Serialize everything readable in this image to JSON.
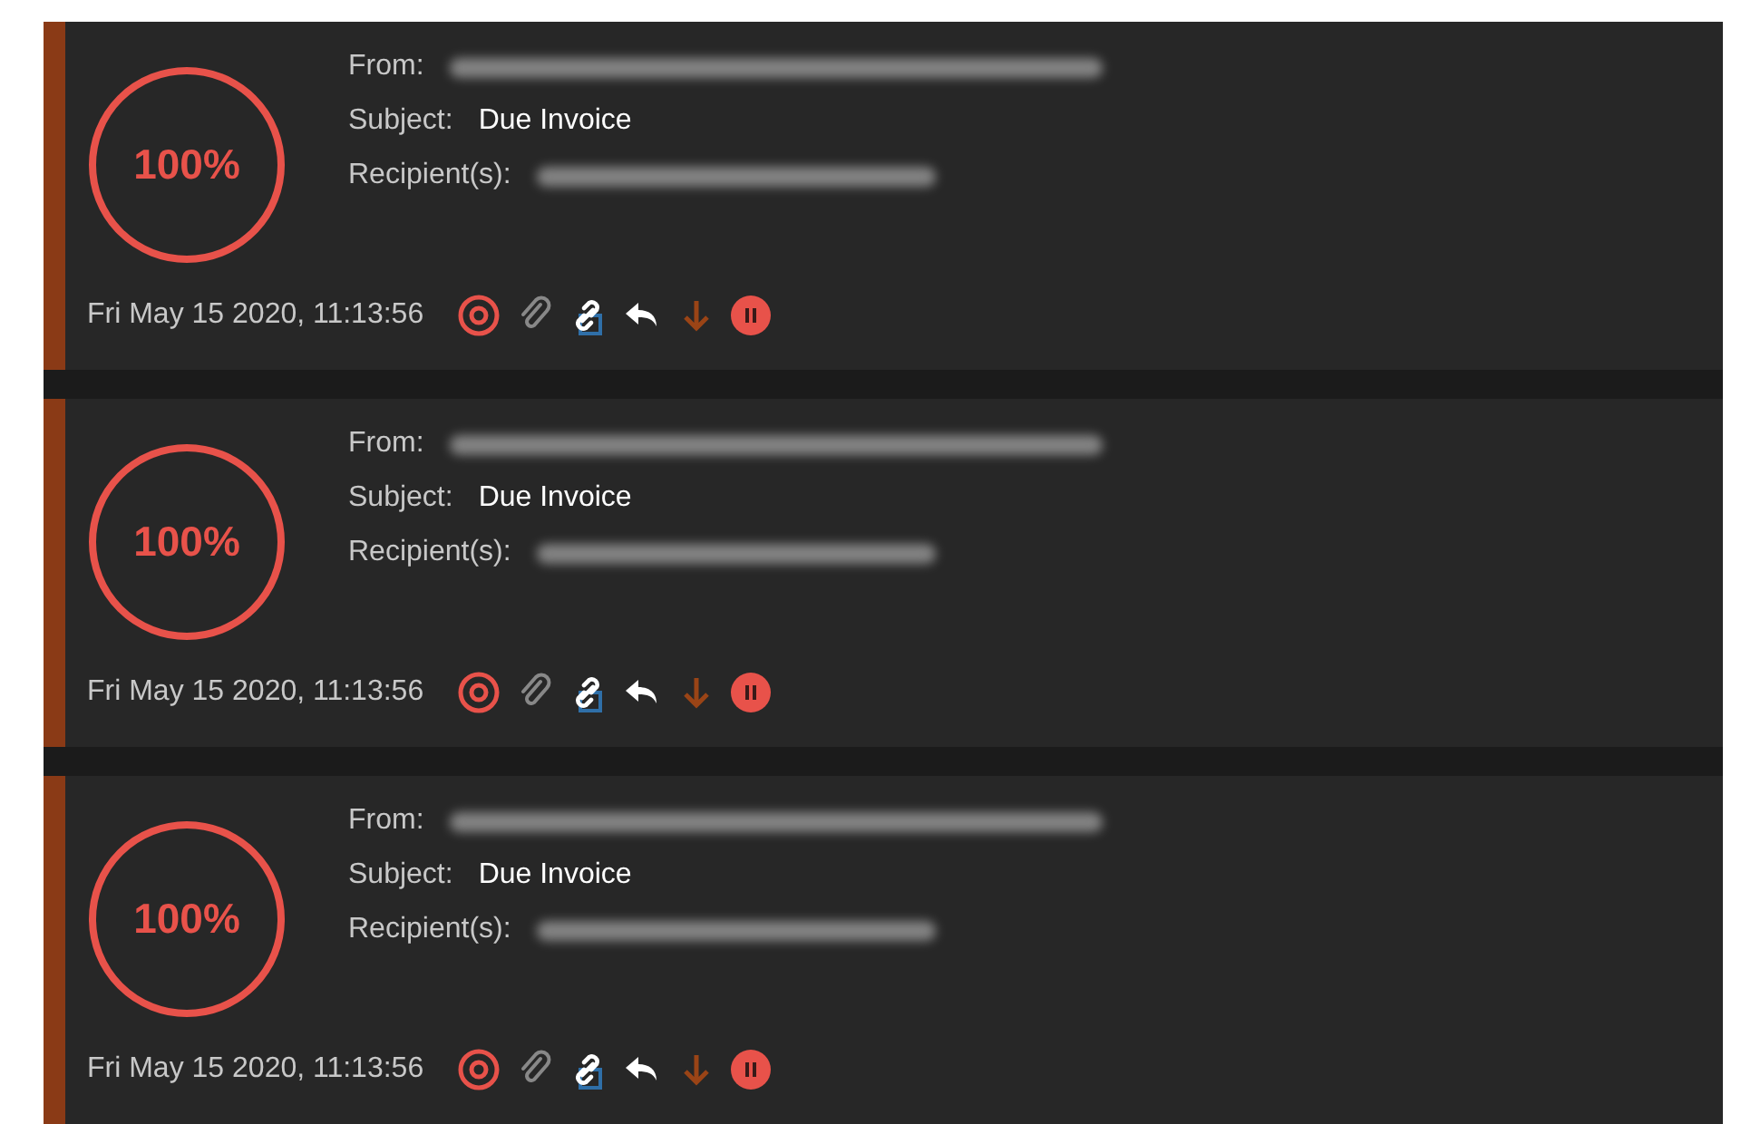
{
  "emails": [
    {
      "score": "100%",
      "from_label": "From:",
      "subject_label": "Subject:",
      "subject": "Due Invoice",
      "recipient_label": "Recipient(s):",
      "date": "Fri May 15 2020, 11:13:56"
    },
    {
      "score": "100%",
      "from_label": "From:",
      "subject_label": "Subject:",
      "subject": "Due Invoice",
      "recipient_label": "Recipient(s):",
      "date": "Fri May 15 2020, 11:13:56"
    },
    {
      "score": "100%",
      "from_label": "From:",
      "subject_label": "Subject:",
      "subject": "Due Invoice",
      "recipient_label": "Recipient(s):",
      "date": "Fri May 15 2020, 11:13:56"
    }
  ]
}
